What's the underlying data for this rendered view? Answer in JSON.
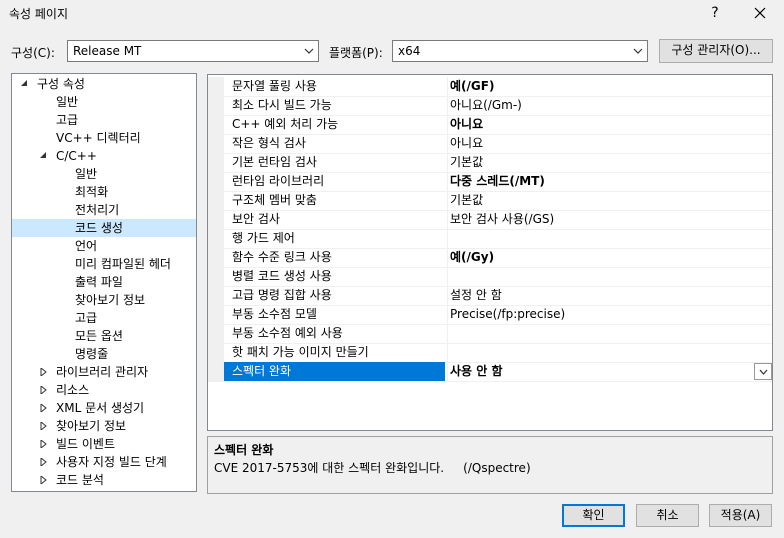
{
  "window": {
    "title": "속성 페이지",
    "help_label": "?"
  },
  "config": {
    "config_label": "구성(C):",
    "config_value": "Release MT",
    "platform_label": "플랫폼(P):",
    "platform_value": "x64",
    "manager_button": "구성 관리자(O)..."
  },
  "tree": {
    "root": "구성 속성",
    "items": [
      "일반",
      "고급",
      "VC++ 디렉터리",
      "C/C++",
      "일반",
      "최적화",
      "전처리기",
      "코드 생성",
      "언어",
      "미리 컴파일된 헤더",
      "출력 파일",
      "찾아보기 정보",
      "고급",
      "모든 옵션",
      "명령줄",
      "라이브러리 관리자",
      "리소스",
      "XML 문서 생성기",
      "찾아보기 정보",
      "빌드 이벤트",
      "사용자 지정 빌드 단계",
      "코드 분석"
    ]
  },
  "grid": {
    "rows": [
      {
        "name": "문자열 풀링 사용",
        "value": "예(/GF)"
      },
      {
        "name": "최소 다시 빌드 가능",
        "value": "아니요(/Gm-)"
      },
      {
        "name": "C++ 예외 처리 가능",
        "value": "아니요"
      },
      {
        "name": "작은 형식 검사",
        "value": "아니요"
      },
      {
        "name": "기본 런타임 검사",
        "value": "기본값"
      },
      {
        "name": "런타임 라이브러리",
        "value": "다중 스레드(/MT)"
      },
      {
        "name": "구조체 멤버 맞춤",
        "value": "기본값"
      },
      {
        "name": "보안 검사",
        "value": "보안 검사 사용(/GS)"
      },
      {
        "name": "행 가드 제어",
        "value": ""
      },
      {
        "name": "함수 수준 링크 사용",
        "value": "예(/Gy)"
      },
      {
        "name": "병렬 코드 생성 사용",
        "value": ""
      },
      {
        "name": "고급 명령 집합 사용",
        "value": "설정 안 함"
      },
      {
        "name": "부동 소수점 모델",
        "value": "Precise(/fp:precise)"
      },
      {
        "name": "부동 소수점 예외 사용",
        "value": ""
      },
      {
        "name": "핫 패치 가능 이미지 만들기",
        "value": ""
      },
      {
        "name": "스펙터 완화",
        "value": "사용 안 함"
      }
    ]
  },
  "description": {
    "title": "스펙터 완화",
    "text": "CVE 2017-5753에 대한 스펙터 완화입니다.     (/Qspectre)"
  },
  "buttons": {
    "ok": "확인",
    "cancel": "취소",
    "apply": "적용(A)"
  },
  "colors": {
    "selection": "#0078d7",
    "tree_selection": "#cce8ff",
    "window_bg": "#f0f0f0"
  }
}
